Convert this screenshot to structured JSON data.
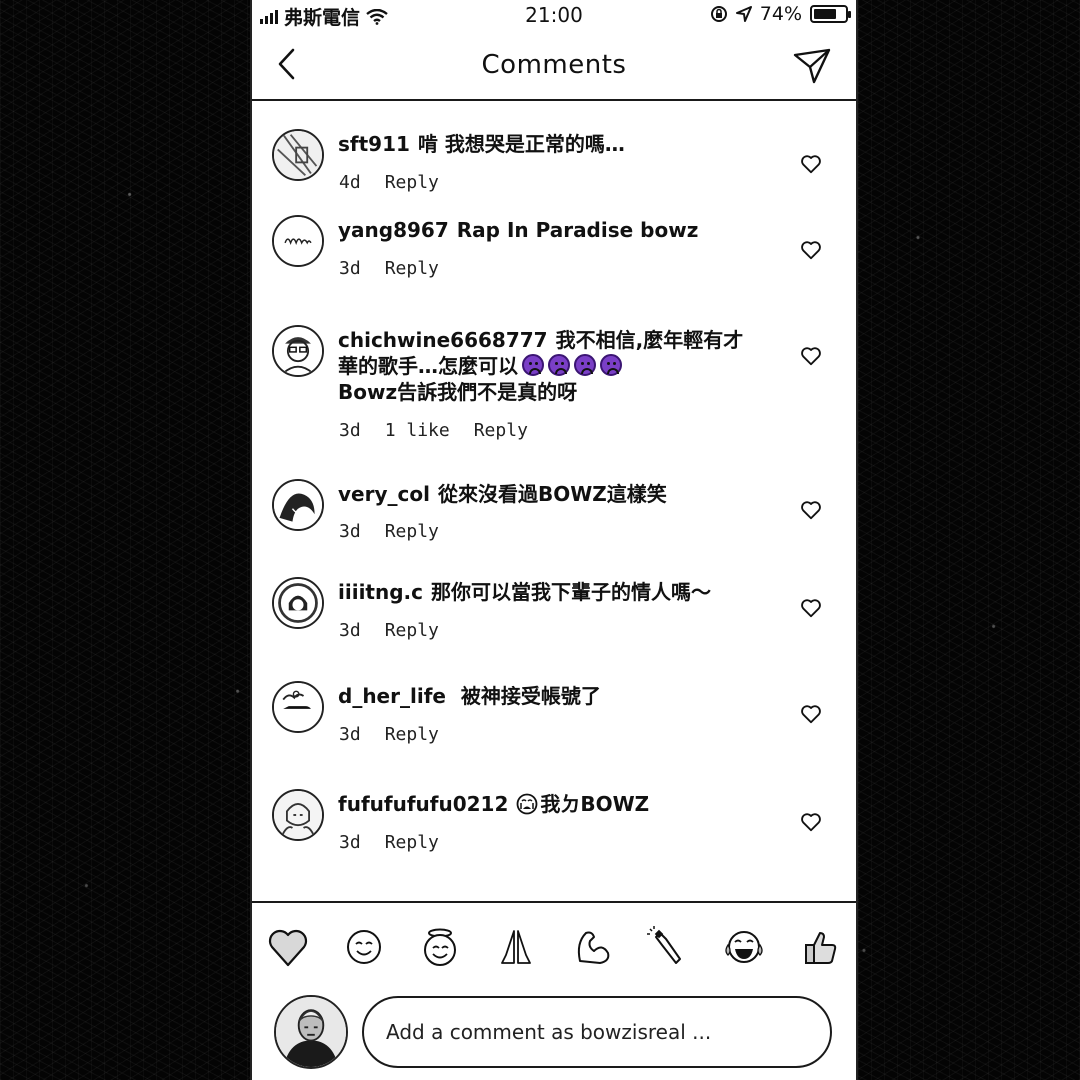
{
  "status_bar": {
    "carrier": "弗斯電信",
    "time": "21:00",
    "battery": "74%",
    "battery_level": 0.74
  },
  "header": {
    "title": "Comments"
  },
  "comments": [
    {
      "user": "sft911",
      "text": "啃  我想哭是正常的嗎…",
      "age": "4d",
      "likes": "",
      "reply": "Reply"
    },
    {
      "user": "yang8967",
      "text": "Rap In Paradise bowz",
      "age": "3d",
      "likes": "",
      "reply": "Reply"
    },
    {
      "user": "chichwine6668777",
      "text": "我不相信,麼年輕有才華的歌手…怎麼可以",
      "text2": "Bowz告訴我們不是真的呀",
      "age": "3d",
      "likes": "1 like",
      "reply": "Reply"
    },
    {
      "user": "very_col",
      "text": "從來沒看過BOWZ這樣笑",
      "age": "3d",
      "likes": "",
      "reply": "Reply"
    },
    {
      "user": "iiiitng.c",
      "text": "那你可以當我下輩子的情人嗎～",
      "age": "3d",
      "likes": "",
      "reply": "Reply"
    },
    {
      "user": "d_her_life",
      "text": " 被神接受帳號了",
      "age": "3d",
      "likes": "",
      "reply": "Reply"
    },
    {
      "user": "fufufufufu0212",
      "text": "我ㄉBOWZ",
      "age": "3d",
      "likes": "",
      "reply": "Reply"
    }
  ],
  "emoji_bar": [
    "heart-emoji",
    "smiling-face-emoji",
    "halo-face-emoji",
    "praying-hands-emoji",
    "flexed-biceps-emoji",
    "champagne-emoji",
    "tears-of-joy-emoji",
    "thumbs-up-emoji"
  ],
  "compose": {
    "placeholder": "Add a comment as bowzisreal ..."
  }
}
